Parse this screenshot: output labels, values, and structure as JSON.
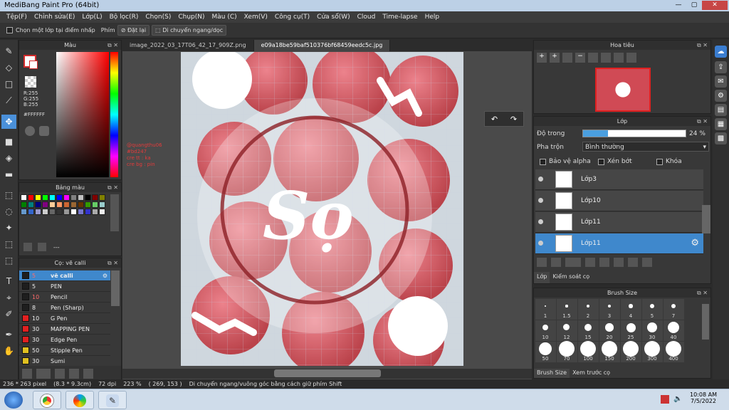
{
  "window": {
    "title": "MediBang Paint Pro (64bit)",
    "min": "—",
    "max": "▢",
    "close": "✕"
  },
  "menu": [
    "Tệp(F)",
    "Chỉnh sửa(E)",
    "Lớp(L)",
    "Bộ lọc(R)",
    "Chọn(S)",
    "Chụp(N)",
    "Màu (C)",
    "Xem(V)",
    "Công cụ(T)",
    "Cửa sổ(W)",
    "Cloud",
    "Time-lapse",
    "Help"
  ],
  "options": {
    "select_layer": "Chọn một lớp tại điểm nhấp",
    "reset_prefix": "Phím",
    "reset": "Đặt lại",
    "move_hv": "Di chuyển ngang/dọc"
  },
  "color": {
    "title": "Màu",
    "r": "R:255",
    "g": "G:255",
    "b": "B:255",
    "hex": "#FFFFFF",
    "primary": "#ffffff",
    "accent": "#d12b2b"
  },
  "swatches": {
    "title": "Bảng màu",
    "footer": "---",
    "colors": [
      "#ffffff",
      "#ff0000",
      "#ffff00",
      "#00ff00",
      "#00ffff",
      "#0000ff",
      "#ff00ff",
      "#808080",
      "#c0c0c0",
      "#000000",
      "#800000",
      "#808000",
      "#008000",
      "#008080",
      "#000080",
      "#800080",
      "#ffcc99",
      "#ff9966",
      "#cc6633",
      "#996633",
      "#663300",
      "#339900",
      "#66cc66",
      "#99cccc",
      "#6699cc",
      "#3366cc",
      "#9999cc",
      "#cccccc",
      "#666666",
      "#333333",
      "#999999",
      "#ffffff",
      "#7777cc",
      "#3333cc",
      "#aaaaaa",
      "#eeeeee"
    ]
  },
  "brush": {
    "title": "Cọ: vẽ calli",
    "items": [
      {
        "size": "5",
        "name": "vẽ calli",
        "color": "#1e1e1e",
        "sel": true
      },
      {
        "size": "5",
        "name": "PEN",
        "color": "#1e1e1e"
      },
      {
        "size": "10",
        "name": "Pencil",
        "color": "#1e1e1e"
      },
      {
        "size": "8",
        "name": "Pen (Sharp)",
        "color": "#1e1e1e"
      },
      {
        "size": "10",
        "name": "G Pen",
        "color": "#e02020"
      },
      {
        "size": "30",
        "name": "MAPPING PEN",
        "color": "#e02020"
      },
      {
        "size": "30",
        "name": "Edge Pen",
        "color": "#e02020"
      },
      {
        "size": "50",
        "name": "Stipple Pen",
        "color": "#e0c020"
      },
      {
        "size": "30",
        "name": "Sumi",
        "color": "#e0c020"
      }
    ]
  },
  "tabs": [
    "image_2022_03_17T06_42_17_909Z.png",
    "e09a18be59baf510376bf68459eedc5c.jpg"
  ],
  "credits": [
    "@quangthu06",
    "#bd247",
    "cre tt : ka",
    "cre bg : pin"
  ],
  "art": {
    "logo": "Sọ"
  },
  "navigator": {
    "title": "Hoa tiêu"
  },
  "layer": {
    "title": "Lớp",
    "opacity_label": "Độ trong",
    "opacity_value": "24 %",
    "opacity": 0.24,
    "blend_label": "Pha trộn",
    "blend_value": "Bình thường",
    "protect_alpha": "Bảo vệ alpha",
    "clip": "Xén bớt",
    "lock": "Khóa",
    "items": [
      {
        "name": "Lớp3"
      },
      {
        "name": "Lớp10"
      },
      {
        "name": "Lớp11"
      },
      {
        "name": "Lớp11",
        "sel": true
      }
    ],
    "tab1": "Lớp",
    "tab2": "Kiểm soát cọ"
  },
  "brushsize": {
    "title": "Brush Size",
    "sizes": [
      "1",
      "1.5",
      "2",
      "3",
      "4",
      "5",
      "7",
      "10",
      "12",
      "15",
      "20",
      "25",
      "30",
      "40",
      "50",
      "70",
      "100",
      "150",
      "200",
      "300",
      "400"
    ],
    "tab1": "Brush Size",
    "tab2": "Xem trước cọ"
  },
  "status": {
    "dims": "236 * 263 pixel",
    "cm": "(8.3 * 9.3cm)",
    "dpi": "72 dpi",
    "zoom": "223 %",
    "coords": "( 269, 153 )",
    "hint": "Di chuyển ngang/vuông góc bằng cách giữ phím Shift"
  },
  "taskbar": {
    "time": "10:08 AM",
    "date": "7/5/2022"
  }
}
